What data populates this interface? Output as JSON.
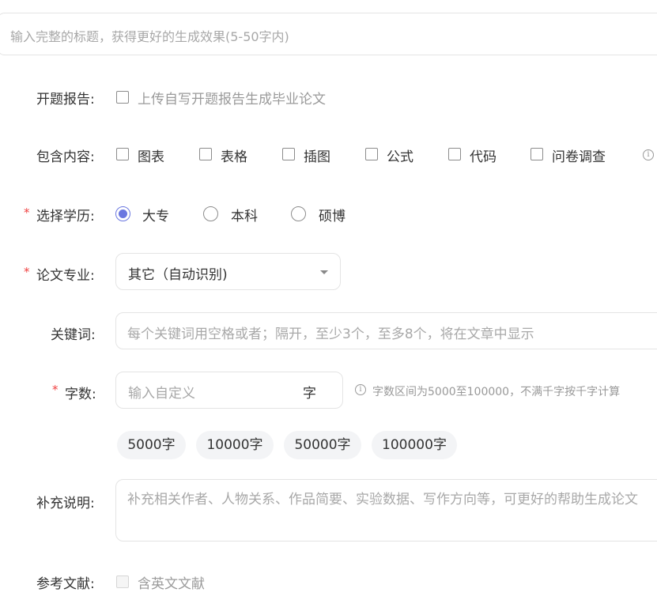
{
  "title_input": {
    "placeholder": "输入完整的标题，获得更好的生成效果(5-50字内)"
  },
  "proposal": {
    "label": "开题报告:",
    "checkbox_label": "上传自写开题报告生成毕业论文"
  },
  "contents": {
    "label": "包含内容:",
    "options": [
      "图表",
      "表格",
      "插图",
      "公式",
      "代码",
      "问卷调查"
    ]
  },
  "degree": {
    "required_mark": "*",
    "label": "选择学历:",
    "options": [
      "大专",
      "本科",
      "硕博"
    ],
    "selected": "大专"
  },
  "major": {
    "required_mark": "*",
    "label": "论文专业:",
    "value": "其它（自动识别)"
  },
  "keywords": {
    "label": "关键词:",
    "placeholder": "每个关键词用空格或者；隔开，至少3个，至多8个，将在文章中显示"
  },
  "word_count": {
    "required_mark": "*",
    "label": "字数:",
    "placeholder": "输入自定义",
    "unit": "字",
    "hint": "字数区间为5000至100000，不满千字按千字计算",
    "presets": [
      "5000字",
      "10000字",
      "50000字",
      "100000字"
    ]
  },
  "supplement": {
    "label": "补充说明:",
    "placeholder": "补充相关作者、人物关系、作品简要、实验数据、写作方向等，可更好的帮助生成论文"
  },
  "references": {
    "label": "参考文献:",
    "checkbox_label": "含英文文献"
  },
  "colors": {
    "accent": "#6a77e0",
    "required": "#f04141"
  }
}
